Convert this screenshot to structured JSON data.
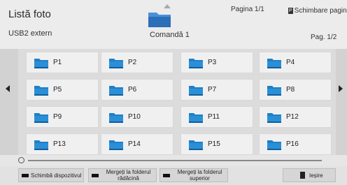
{
  "header": {
    "title": "Listă foto",
    "device": "USB2 extern",
    "command": "Comandă 1",
    "page_top": "Pagina 1/1",
    "change_page_key": "P",
    "change_page": "Schimbare pagină",
    "page": "Pag. 1/2"
  },
  "grid": {
    "folders": [
      "P1",
      "P2",
      "P3",
      "P4",
      "P5",
      "P6",
      "P7",
      "P8",
      "P9",
      "P10",
      "P11",
      "P12",
      "P13",
      "P14",
      "P15",
      "P16"
    ]
  },
  "footer": {
    "buttons": [
      {
        "label": "Schimbă dispozitivul"
      },
      {
        "label": "Mergeți la folderul rădăcină"
      },
      {
        "label": "Mergeți la folderul superior"
      },
      {
        "label": "Ieșire"
      }
    ]
  },
  "colors": {
    "folder": "#1f80c8",
    "background": "#e8e8e8"
  }
}
